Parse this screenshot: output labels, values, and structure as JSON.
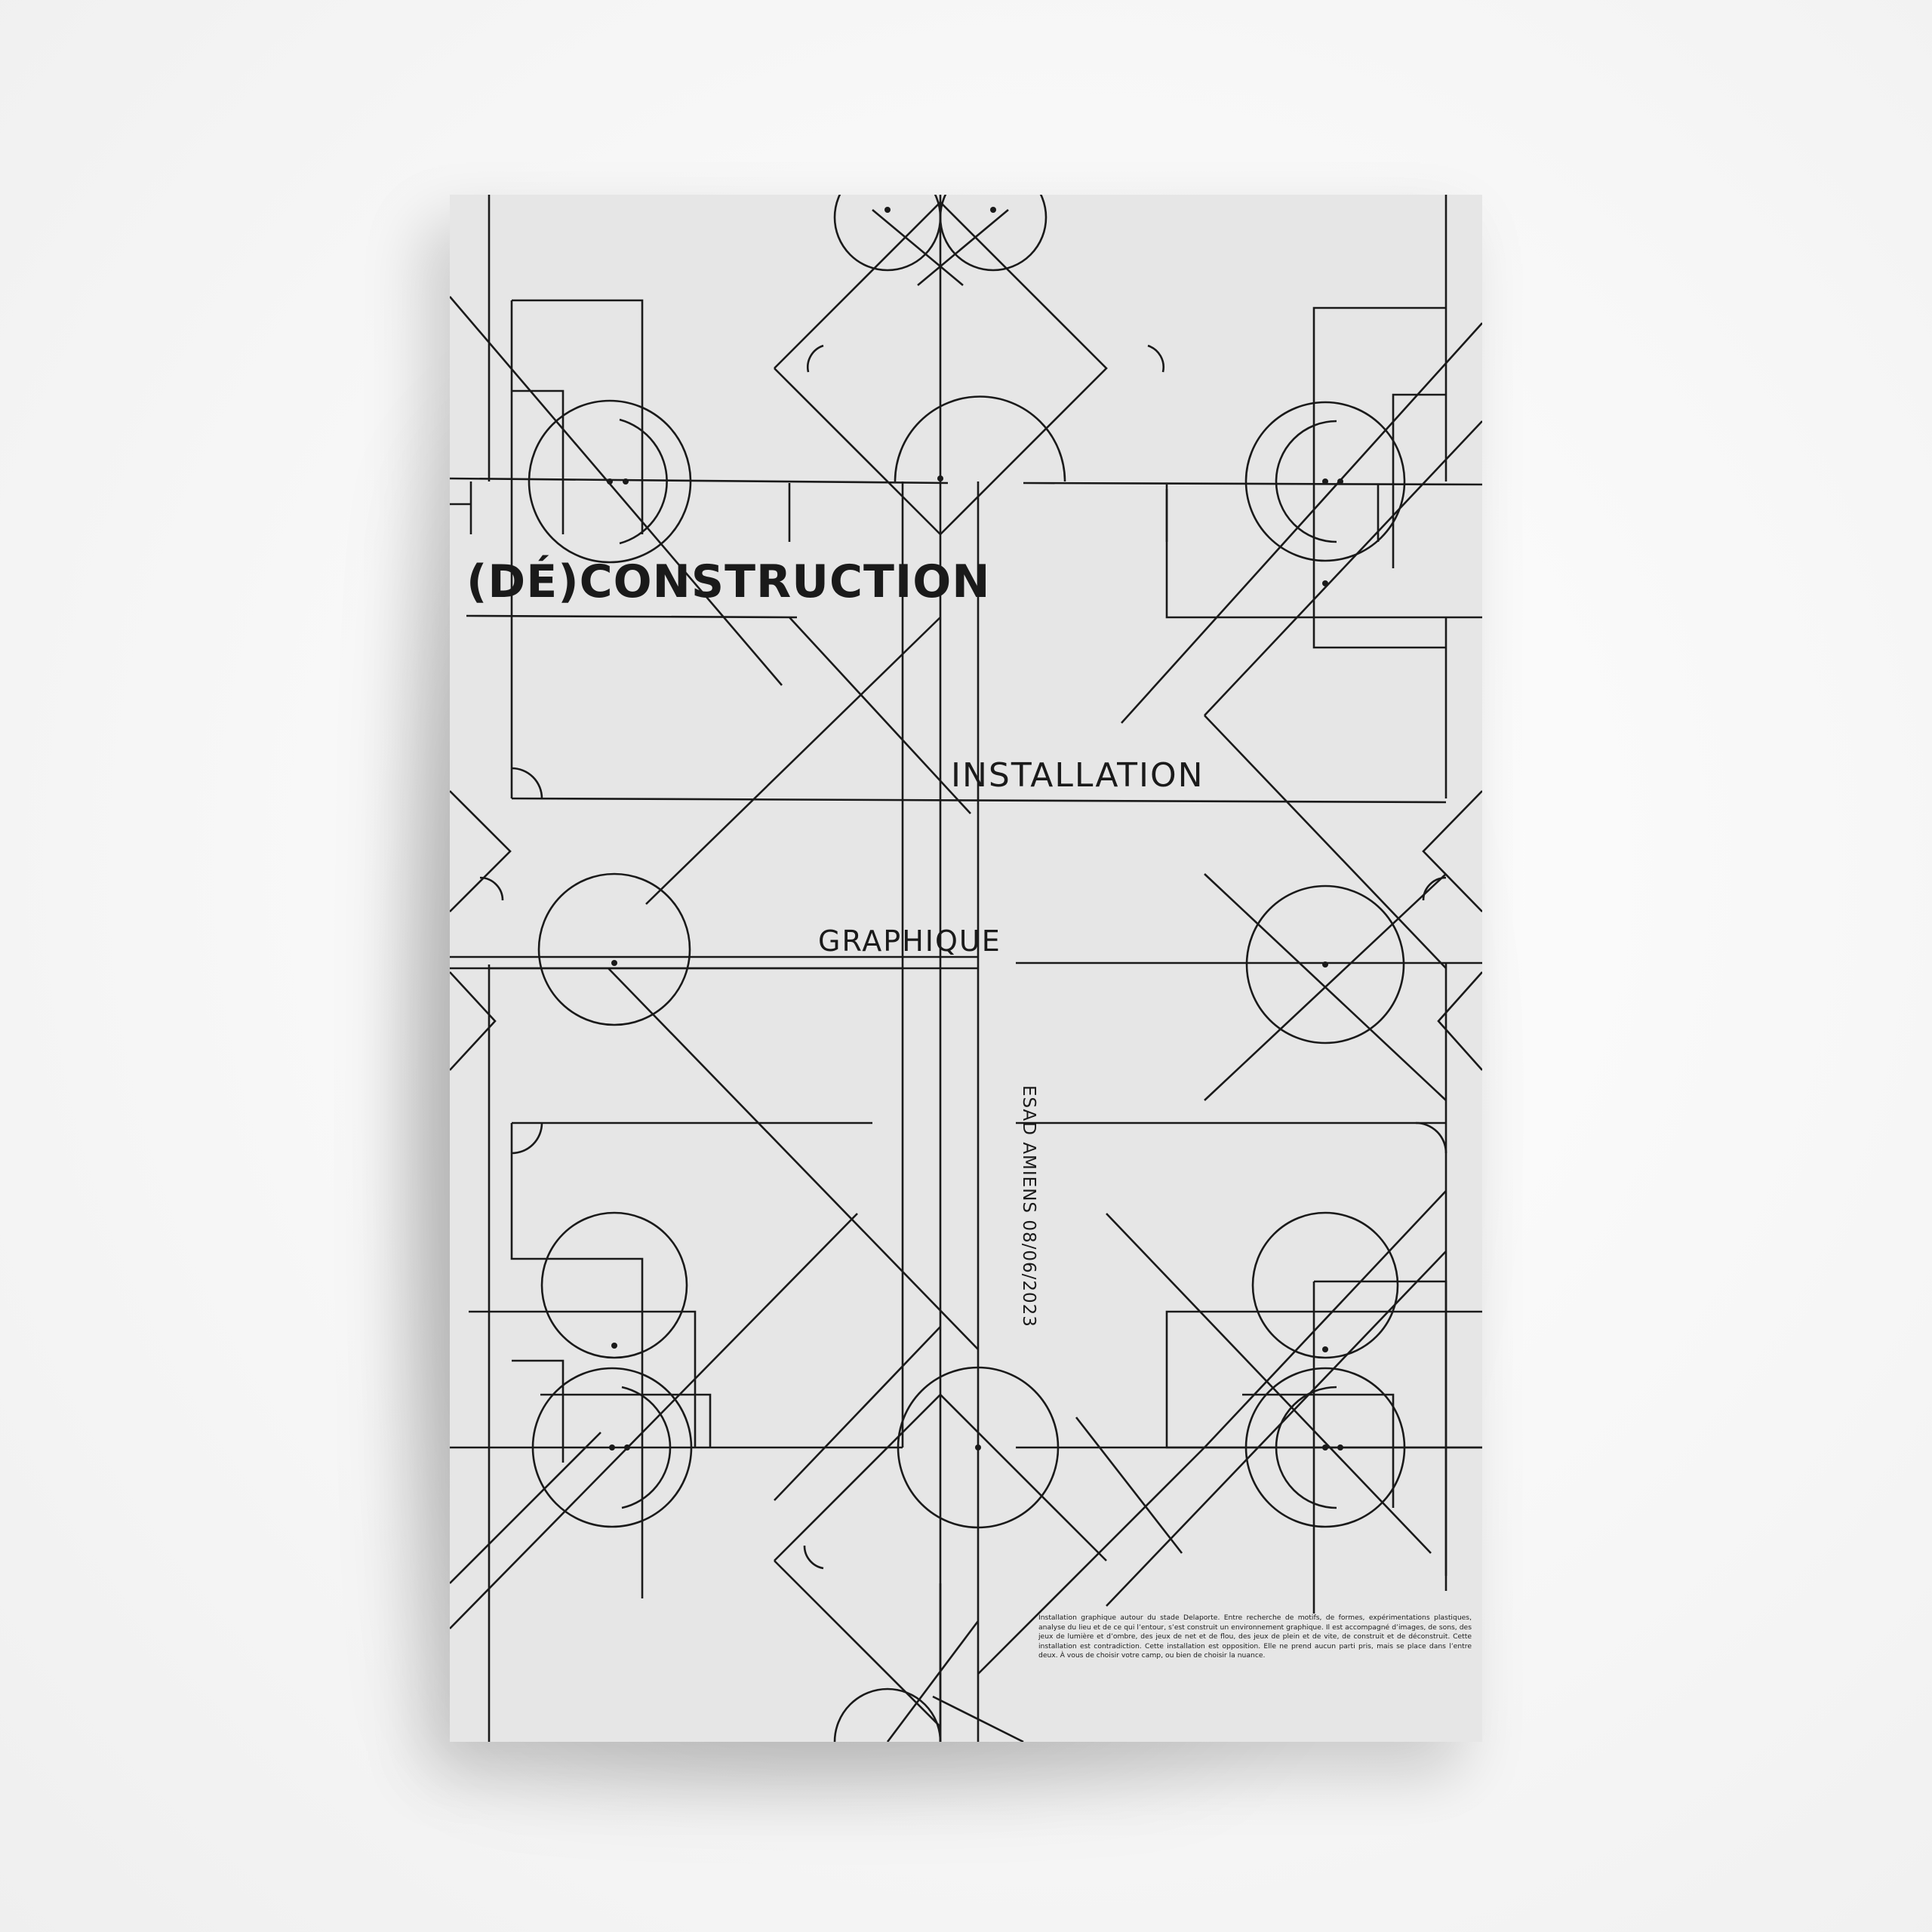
{
  "poster": {
    "title": "(DÉ)CONSTRUCTION",
    "line2": "INSTALLATION",
    "line3": "GRAPHIQUE",
    "vertical_credit": "ESAD AMIENS 08/06/2023",
    "body": "Installation graphique autour du stade Delaporte. Entre recherche de motifs, de formes, expérimentations plastiques, analyse du lieu et de ce qui l’entour, s’est construit un environnement graphique. Il est accompagné d’images, de sons, des jeux de lumière et d’ombre, des jeux de net et de flou, des jeux de plein et de vite, de construit et de déconstruit. Cette installation est contradiction. Cette installation est opposition. Elle ne prend aucun parti pris, mais se place dans l’entre deux. À vous de choisir votre camp, ou bien de choisir la nuance."
  },
  "colors": {
    "paper": "#e6e6e6",
    "ink": "#1a1a1a",
    "background": "#f7f7f7"
  }
}
